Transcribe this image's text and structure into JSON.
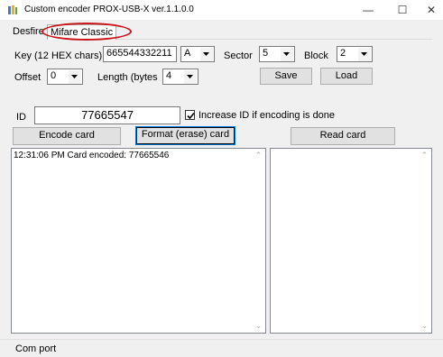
{
  "window": {
    "title": "Custom encoder PROX-USB-X ver.1.1.0.0",
    "minimize": "—",
    "maximize": "☐",
    "close": "✕"
  },
  "tabs": [
    {
      "label": "Desfire"
    },
    {
      "label": "Mifare Classic"
    }
  ],
  "form": {
    "key_label": "Key (12 HEX chars)",
    "key_value": "665544332211",
    "key_type_value": "A",
    "sector_label": "Sector",
    "sector_value": "5",
    "block_label": "Block",
    "block_value": "2",
    "offset_label": "Offset",
    "offset_value": "0",
    "length_label": "Length (bytes",
    "length_value": "4",
    "save_label": "Save",
    "load_label": "Load",
    "id_label": "ID",
    "id_value": "77665547",
    "increase_label": "Increase ID if encoding is done",
    "increase_checked": true
  },
  "actions": {
    "encode_label": "Encode card",
    "format_label": "Format (erase) card",
    "read_label": "Read card"
  },
  "log": {
    "lines": [
      "12:31:06 PM Card encoded: 77665546"
    ]
  },
  "status": {
    "text": "Com port"
  },
  "colors": {
    "callout": "#c8161b",
    "focus": "#0078d7"
  }
}
